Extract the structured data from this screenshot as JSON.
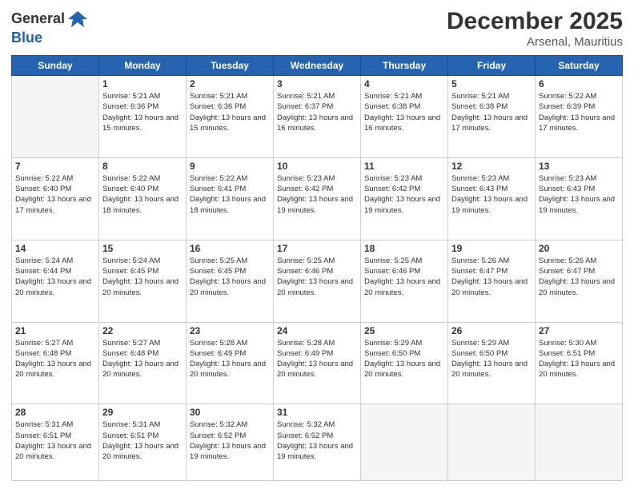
{
  "header": {
    "logo_general": "General",
    "logo_blue": "Blue",
    "month_year": "December 2025",
    "location": "Arsenal, Mauritius"
  },
  "weekdays": [
    "Sunday",
    "Monday",
    "Tuesday",
    "Wednesday",
    "Thursday",
    "Friday",
    "Saturday"
  ],
  "weeks": [
    [
      {
        "day": "",
        "empty": true
      },
      {
        "day": "1",
        "sunrise": "5:21 AM",
        "sunset": "6:36 PM",
        "daylight": "13 hours and 15 minutes."
      },
      {
        "day": "2",
        "sunrise": "5:21 AM",
        "sunset": "6:36 PM",
        "daylight": "13 hours and 15 minutes."
      },
      {
        "day": "3",
        "sunrise": "5:21 AM",
        "sunset": "6:37 PM",
        "daylight": "13 hours and 16 minutes."
      },
      {
        "day": "4",
        "sunrise": "5:21 AM",
        "sunset": "6:38 PM",
        "daylight": "13 hours and 16 minutes."
      },
      {
        "day": "5",
        "sunrise": "5:21 AM",
        "sunset": "6:38 PM",
        "daylight": "13 hours and 17 minutes."
      },
      {
        "day": "6",
        "sunrise": "5:22 AM",
        "sunset": "6:39 PM",
        "daylight": "13 hours and 17 minutes."
      }
    ],
    [
      {
        "day": "7",
        "sunrise": "5:22 AM",
        "sunset": "6:40 PM",
        "daylight": "13 hours and 17 minutes."
      },
      {
        "day": "8",
        "sunrise": "5:22 AM",
        "sunset": "6:40 PM",
        "daylight": "13 hours and 18 minutes."
      },
      {
        "day": "9",
        "sunrise": "5:22 AM",
        "sunset": "6:41 PM",
        "daylight": "13 hours and 18 minutes."
      },
      {
        "day": "10",
        "sunrise": "5:23 AM",
        "sunset": "6:42 PM",
        "daylight": "13 hours and 19 minutes."
      },
      {
        "day": "11",
        "sunrise": "5:23 AM",
        "sunset": "6:42 PM",
        "daylight": "13 hours and 19 minutes."
      },
      {
        "day": "12",
        "sunrise": "5:23 AM",
        "sunset": "6:43 PM",
        "daylight": "13 hours and 19 minutes."
      },
      {
        "day": "13",
        "sunrise": "5:23 AM",
        "sunset": "6:43 PM",
        "daylight": "13 hours and 19 minutes."
      }
    ],
    [
      {
        "day": "14",
        "sunrise": "5:24 AM",
        "sunset": "6:44 PM",
        "daylight": "13 hours and 20 minutes."
      },
      {
        "day": "15",
        "sunrise": "5:24 AM",
        "sunset": "6:45 PM",
        "daylight": "13 hours and 20 minutes."
      },
      {
        "day": "16",
        "sunrise": "5:25 AM",
        "sunset": "6:45 PM",
        "daylight": "13 hours and 20 minutes."
      },
      {
        "day": "17",
        "sunrise": "5:25 AM",
        "sunset": "6:46 PM",
        "daylight": "13 hours and 20 minutes."
      },
      {
        "day": "18",
        "sunrise": "5:25 AM",
        "sunset": "6:46 PM",
        "daylight": "13 hours and 20 minutes."
      },
      {
        "day": "19",
        "sunrise": "5:26 AM",
        "sunset": "6:47 PM",
        "daylight": "13 hours and 20 minutes."
      },
      {
        "day": "20",
        "sunrise": "5:26 AM",
        "sunset": "6:47 PM",
        "daylight": "13 hours and 20 minutes."
      }
    ],
    [
      {
        "day": "21",
        "sunrise": "5:27 AM",
        "sunset": "6:48 PM",
        "daylight": "13 hours and 20 minutes."
      },
      {
        "day": "22",
        "sunrise": "5:27 AM",
        "sunset": "6:48 PM",
        "daylight": "13 hours and 20 minutes."
      },
      {
        "day": "23",
        "sunrise": "5:28 AM",
        "sunset": "6:49 PM",
        "daylight": "13 hours and 20 minutes."
      },
      {
        "day": "24",
        "sunrise": "5:28 AM",
        "sunset": "6:49 PM",
        "daylight": "13 hours and 20 minutes."
      },
      {
        "day": "25",
        "sunrise": "5:29 AM",
        "sunset": "6:50 PM",
        "daylight": "13 hours and 20 minutes."
      },
      {
        "day": "26",
        "sunrise": "5:29 AM",
        "sunset": "6:50 PM",
        "daylight": "13 hours and 20 minutes."
      },
      {
        "day": "27",
        "sunrise": "5:30 AM",
        "sunset": "6:51 PM",
        "daylight": "13 hours and 20 minutes."
      }
    ],
    [
      {
        "day": "28",
        "sunrise": "5:31 AM",
        "sunset": "6:51 PM",
        "daylight": "13 hours and 20 minutes."
      },
      {
        "day": "29",
        "sunrise": "5:31 AM",
        "sunset": "6:51 PM",
        "daylight": "13 hours and 20 minutes."
      },
      {
        "day": "30",
        "sunrise": "5:32 AM",
        "sunset": "6:52 PM",
        "daylight": "13 hours and 19 minutes."
      },
      {
        "day": "31",
        "sunrise": "5:32 AM",
        "sunset": "6:52 PM",
        "daylight": "13 hours and 19 minutes."
      },
      {
        "day": "",
        "empty": true
      },
      {
        "day": "",
        "empty": true
      },
      {
        "day": "",
        "empty": true
      }
    ]
  ]
}
